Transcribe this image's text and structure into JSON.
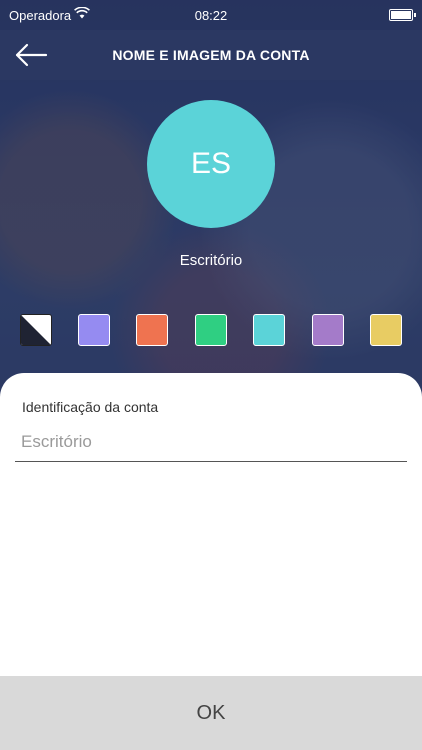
{
  "status_bar": {
    "carrier": "Operadora",
    "time": "08:22"
  },
  "header": {
    "title": "NOME E IMAGEM DA CONTA"
  },
  "avatar": {
    "initials": "ES",
    "name": "Escritório",
    "color": "#5bd3d8"
  },
  "swatches": [
    {
      "name": "none",
      "color": "#ffffff"
    },
    {
      "name": "periwinkle",
      "color": "#958bf1"
    },
    {
      "name": "orange",
      "color": "#ef7350"
    },
    {
      "name": "green",
      "color": "#2fcf82"
    },
    {
      "name": "teal",
      "color": "#5bd3d8"
    },
    {
      "name": "purple",
      "color": "#a47bc9"
    },
    {
      "name": "yellow",
      "color": "#e8cc63"
    }
  ],
  "form": {
    "label": "Identificação da conta",
    "placeholder": "Escritório",
    "value": ""
  },
  "footer": {
    "ok_label": "OK"
  }
}
